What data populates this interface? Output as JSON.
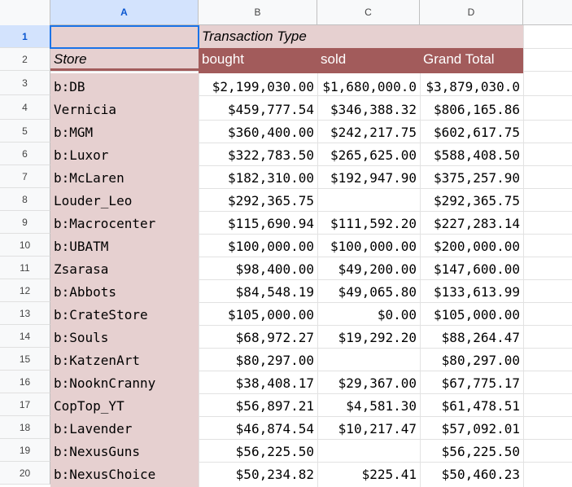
{
  "columns": [
    "A",
    "B",
    "C",
    "D"
  ],
  "selected_column": "A",
  "selected_row": 1,
  "row_numbers": [
    "1",
    "2",
    "3",
    "4",
    "5",
    "6",
    "7",
    "8",
    "9",
    "10",
    "11",
    "12",
    "13",
    "14",
    "15",
    "16",
    "17",
    "18",
    "19",
    "20"
  ],
  "pivot": {
    "row1": {
      "a": "",
      "b": "Transaction Type"
    },
    "header": {
      "store": "Store",
      "bought": "bought",
      "sold": "sold",
      "grand_total": "Grand Total"
    },
    "rows": [
      {
        "store": "b:DB",
        "bought": "$2,199,030.00",
        "sold": "$1,680,000.0",
        "total": "$3,879,030.0"
      },
      {
        "store": "Vernicia",
        "bought": "$459,777.54",
        "sold": "$346,388.32",
        "total": "$806,165.86"
      },
      {
        "store": "b:MGM",
        "bought": "$360,400.00",
        "sold": "$242,217.75",
        "total": "$602,617.75"
      },
      {
        "store": "b:Luxor",
        "bought": "$322,783.50",
        "sold": "$265,625.00",
        "total": "$588,408.50"
      },
      {
        "store": "b:McLaren",
        "bought": "$182,310.00",
        "sold": "$192,947.90",
        "total": "$375,257.90"
      },
      {
        "store": "Louder_Leo",
        "bought": "$292,365.75",
        "sold": "",
        "total": "$292,365.75"
      },
      {
        "store": "b:Macrocenter",
        "bought": "$115,690.94",
        "sold": "$111,592.20",
        "total": "$227,283.14"
      },
      {
        "store": "b:UBATM",
        "bought": "$100,000.00",
        "sold": "$100,000.00",
        "total": "$200,000.00"
      },
      {
        "store": "Zsarasa",
        "bought": "$98,400.00",
        "sold": "$49,200.00",
        "total": "$147,600.00"
      },
      {
        "store": "b:Abbots",
        "bought": "$84,548.19",
        "sold": "$49,065.80",
        "total": "$133,613.99"
      },
      {
        "store": "b:CrateStore",
        "bought": "$105,000.00",
        "sold": "$0.00",
        "total": "$105,000.00"
      },
      {
        "store": "b:Souls",
        "bought": "$68,972.27",
        "sold": "$19,292.20",
        "total": "$88,264.47"
      },
      {
        "store": "b:KatzenArt",
        "bought": "$80,297.00",
        "sold": "",
        "total": "$80,297.00"
      },
      {
        "store": "b:NooknCranny",
        "bought": "$38,408.17",
        "sold": "$29,367.00",
        "total": "$67,775.17"
      },
      {
        "store": "CopTop_YT",
        "bought": "$56,897.21",
        "sold": "$4,581.30",
        "total": "$61,478.51"
      },
      {
        "store": "b:Lavender",
        "bought": "$46,874.54",
        "sold": "$10,217.47",
        "total": "$57,092.01"
      },
      {
        "store": "b:NexusGuns",
        "bought": "$56,225.50",
        "sold": "",
        "total": "$56,225.50"
      },
      {
        "store": "b:NexusChoice",
        "bought": "$50,234.82",
        "sold": "$225.41",
        "total": "$50,460.23"
      }
    ]
  },
  "colors": {
    "header_fill": "#a25b5b",
    "light_fill": "#e6d0d0",
    "selection": "#1a73e8",
    "header_bg": "#f8f9fa",
    "selected_header_bg": "#d3e3fd"
  }
}
